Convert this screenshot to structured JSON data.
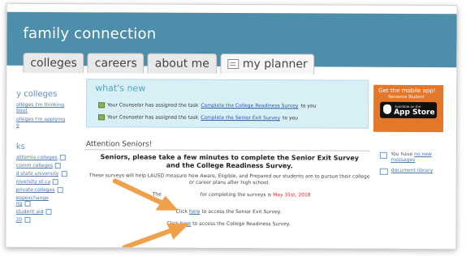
{
  "header": {
    "brand": "family connection",
    "tabs": [
      {
        "label": "colleges"
      },
      {
        "label": "careers"
      },
      {
        "label": "about me"
      },
      {
        "label": "my planner"
      }
    ]
  },
  "sidebar": {
    "colleges_heading": "y colleges",
    "colleges_links": [
      "olleges I'm thinking",
      "bout",
      "olleges I'm applying",
      "o"
    ],
    "links_heading": "ks",
    "links": [
      "alifornia colleges",
      "comm colleges",
      "d state university",
      "niversity of ca",
      "private colleges",
      "eopexchange",
      "ng",
      "student aid",
      "20"
    ]
  },
  "whats_new": {
    "title": "what's new",
    "items": [
      {
        "prefix": "Your Counselor has assigned the task",
        "link": "Complete the College Readiness Survey",
        "suffix": "to you"
      },
      {
        "prefix": "Your Counselor has assigned the task",
        "link": "Complete the Senior Exit Survey",
        "suffix": "to you"
      }
    ]
  },
  "ad": {
    "line1": "Get the mobile app!",
    "line2": "Naviance Student",
    "badge_small": "Available on the",
    "badge_big": "App Store"
  },
  "right": {
    "messages_prefix": "You have",
    "messages_link": "no new messages",
    "library_link": "document library"
  },
  "attention": {
    "title": "Attention Seniors!",
    "headline": "Seniors, please take a few minutes to complete the Senior Exit Survey and the College Readiness Survey.",
    "body": "These surveys will help LAUSD measure how Aware, Eligible, and Prepared our students are to pursue their college or career plans after high school.",
    "deadline_prefix": "The",
    "deadline_middle": "for completing the surveys is",
    "deadline_date": "May 31st, 2018",
    "exit_prefix": "Click",
    "exit_link": "here",
    "exit_suffix": "to access the Senior Exit Survey.",
    "readiness_prefix": "Click",
    "readiness_link": "here",
    "readiness_suffix": "to access the College Readiness Survey."
  },
  "colors": {
    "header": "#4d8eab",
    "whats_new_bg": "#d8eff6",
    "ad_orange": "#e3772a",
    "arrow": "#f0a04a",
    "deadline": "#dd2222"
  }
}
